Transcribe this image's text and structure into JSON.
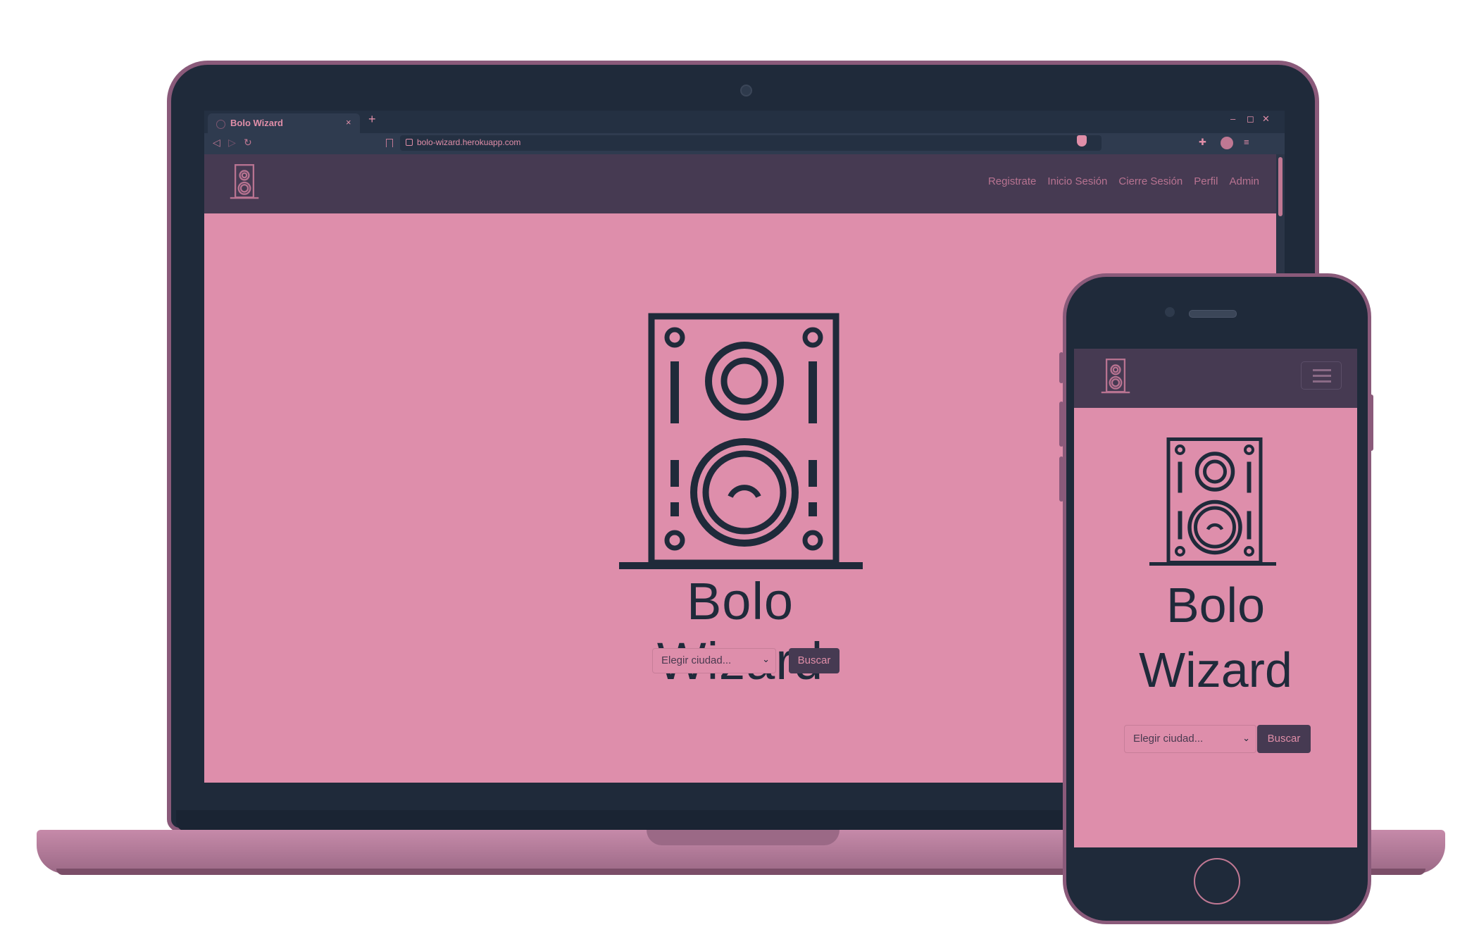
{
  "browser": {
    "tab_title": "Bolo Wizard",
    "tab_close": "×",
    "new_tab": "+",
    "url": "bolo-wizard.herokuapp.com",
    "window_controls": [
      "–",
      "◻",
      "✕"
    ]
  },
  "site": {
    "nav_links": [
      "Registrate",
      "Inicio Sesión",
      "Cierre Sesión",
      "Perfil",
      "Admin"
    ],
    "title": "Bolo Wizard",
    "city_placeholder": "Elegir ciudad...",
    "search_button": "Buscar"
  },
  "mobile": {
    "title_line1": "Bolo",
    "title_line2": "Wizard",
    "city_placeholder": "Elegir ciudad...",
    "search_button": "Buscar"
  },
  "colors": {
    "accent": "#de8eab",
    "dark": "#1f2a3a",
    "navbar": "#463a52",
    "device_frame": "#8a5a7a"
  },
  "icons": [
    "speaker-logo-icon",
    "globe-icon",
    "lock-icon",
    "bookmark-icon",
    "back-icon",
    "forward-icon",
    "reload-icon",
    "extension-icon",
    "menu-icon",
    "hamburger-icon",
    "chevron-down-icon"
  ]
}
